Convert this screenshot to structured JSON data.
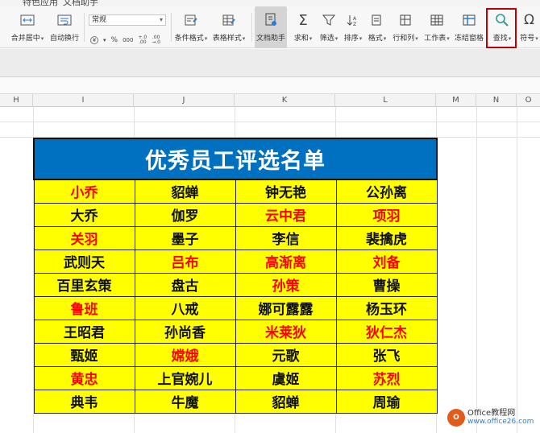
{
  "menu": {
    "items": [
      "特色应用",
      "文档助手"
    ]
  },
  "ribbon": {
    "merge_center": "合并居中",
    "wrap_text": "自动换行",
    "number_format": "常规",
    "percent": "%",
    "thousands": "000",
    "conditional_format": "条件格式",
    "table_style": "表格样式",
    "doc_assistant": "文档助手",
    "sum": "求和",
    "filter": "筛选",
    "sort": "排序",
    "format": "格式",
    "row_col": "行和列",
    "worksheet": "工作表",
    "freeze": "冻结窗格",
    "find": "查找",
    "symbol": "符号"
  },
  "columns": [
    "H",
    "I",
    "J",
    "K",
    "L",
    "M",
    "N",
    "O"
  ],
  "table": {
    "title": "优秀员工评选名单",
    "rows": [
      [
        {
          "t": "小乔",
          "red": true
        },
        {
          "t": "貂蝉",
          "red": false
        },
        {
          "t": "钟无艳",
          "red": false
        },
        {
          "t": "公孙离",
          "red": false
        }
      ],
      [
        {
          "t": "大乔",
          "red": false
        },
        {
          "t": "伽罗",
          "red": false
        },
        {
          "t": "云中君",
          "red": true
        },
        {
          "t": "项羽",
          "red": true
        }
      ],
      [
        {
          "t": "关羽",
          "red": true
        },
        {
          "t": "墨子",
          "red": false
        },
        {
          "t": "李信",
          "red": false
        },
        {
          "t": "裴擒虎",
          "red": false
        }
      ],
      [
        {
          "t": "武则天",
          "red": false
        },
        {
          "t": "吕布",
          "red": true
        },
        {
          "t": "高渐离",
          "red": true
        },
        {
          "t": "刘备",
          "red": true
        }
      ],
      [
        {
          "t": "百里玄策",
          "red": false
        },
        {
          "t": "盘古",
          "red": false
        },
        {
          "t": "孙策",
          "red": true
        },
        {
          "t": "曹操",
          "red": false
        }
      ],
      [
        {
          "t": "鲁班",
          "red": true
        },
        {
          "t": "八戒",
          "red": false
        },
        {
          "t": "娜可露露",
          "red": false
        },
        {
          "t": "杨玉环",
          "red": false
        }
      ],
      [
        {
          "t": "王昭君",
          "red": false
        },
        {
          "t": "孙尚香",
          "red": false
        },
        {
          "t": "米莱狄",
          "red": true
        },
        {
          "t": "狄仁杰",
          "red": true
        }
      ],
      [
        {
          "t": "甄姬",
          "red": false
        },
        {
          "t": "嫦娥",
          "red": true
        },
        {
          "t": "元歌",
          "red": false
        },
        {
          "t": "张飞",
          "red": false
        }
      ],
      [
        {
          "t": "黄忠",
          "red": true
        },
        {
          "t": "上官婉儿",
          "red": false
        },
        {
          "t": "虞姬",
          "red": false
        },
        {
          "t": "苏烈",
          "red": true
        }
      ],
      [
        {
          "t": "典韦",
          "red": false
        },
        {
          "t": "牛魔",
          "red": false
        },
        {
          "t": "貂蝉",
          "red": false
        },
        {
          "t": "周瑜",
          "red": false
        }
      ]
    ]
  },
  "watermark": {
    "logo": "O",
    "line1": "Office教程网",
    "line2": "www.office26.com"
  },
  "colors": {
    "title_bg": "#0070c0",
    "cell_bg": "#ffff00",
    "highlight": "#ff0000",
    "find_box": "#c00000"
  }
}
